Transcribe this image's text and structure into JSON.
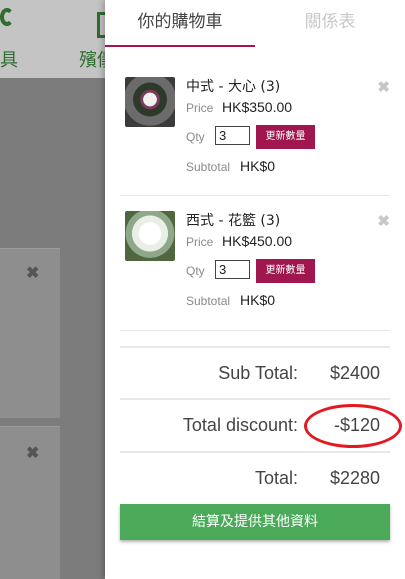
{
  "background": {
    "nav_left_label": "具",
    "nav_mid_label": "殯儀",
    "close_symbol": "✖"
  },
  "drawer": {
    "tabs": [
      {
        "label": "你的購物車",
        "active": true
      },
      {
        "label": "關係表",
        "active": false
      }
    ],
    "items": [
      {
        "name": "中式 - 大心 (3)",
        "price_label": "Price",
        "price": "HK$350.00",
        "qty_label": "Qty",
        "qty": "3",
        "update_label": "更新數量",
        "subtotal_label": "Subtotal",
        "subtotal": "HK$0",
        "remove_symbol": "✖"
      },
      {
        "name": "西式 - 花籃 (3)",
        "price_label": "Price",
        "price": "HK$450.00",
        "qty_label": "Qty",
        "qty": "3",
        "update_label": "更新數量",
        "subtotal_label": "Subtotal",
        "subtotal": "HK$0",
        "remove_symbol": "✖"
      }
    ],
    "totals": {
      "sub_total_label": "Sub Total:",
      "sub_total": "$2400",
      "discount_label": "Total discount:",
      "discount": "-$120",
      "total_label": "Total:",
      "total": "$2280"
    },
    "checkout_label": "結算及提供其他資料"
  },
  "colors": {
    "accent": "#a0174f",
    "checkout_green": "#4aaa5a",
    "annotation_red": "#e3191f"
  }
}
